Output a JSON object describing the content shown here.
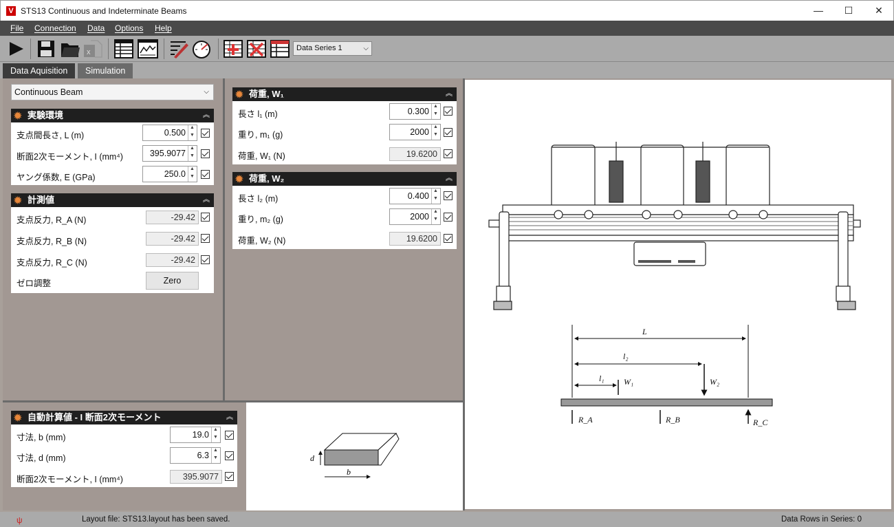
{
  "window": {
    "title": "STS13 Continuous and Indeterminate Beams",
    "logo_letter": "V",
    "min_glyph": "—",
    "max_glyph": "☐",
    "close_glyph": "✕"
  },
  "menu": [
    "File",
    "Connection",
    "Data",
    "Options",
    "Help"
  ],
  "toolbar": {
    "data_series": "Data Series 1",
    "icons": [
      "play-icon",
      "save-icon",
      "open-folder-icon",
      "excel-icon",
      "file-icon",
      "table-icon",
      "graph-icon",
      "pencil-ruler-icon",
      "gauge-icon",
      "add-column-icon",
      "delete-column-icon",
      "table-settings-icon"
    ]
  },
  "tabs": [
    "Data Aquisition",
    "Simulation"
  ],
  "beam_type": "Continuous Beam",
  "env": {
    "title": "実験環境",
    "rows": [
      {
        "label": "支点間長さ, L (m)",
        "value": "0.500"
      },
      {
        "label": "断面2次モーメント, I (mm⁴)",
        "value": "395.9077"
      },
      {
        "label": "ヤング係数, E (GPa)",
        "value": "250.0"
      }
    ]
  },
  "measure": {
    "title": "計測値",
    "rows": [
      {
        "label": "支点反力, R_A (N)",
        "value": "-29.42"
      },
      {
        "label": "支点反力, R_B (N)",
        "value": "-29.42"
      },
      {
        "label": "支点反力, R_C (N)",
        "value": "-29.42"
      }
    ],
    "zero_label": "ゼロ調整",
    "zero_button": "Zero"
  },
  "w1": {
    "title": "荷重, W₁",
    "rows": [
      {
        "label": "長さ l₁ (m)",
        "value": "0.300"
      },
      {
        "label": "重り, m₁ (g)",
        "value": "2000"
      },
      {
        "label": "荷重, W₁ (N)",
        "value": "19.6200"
      }
    ]
  },
  "w2": {
    "title": "荷重, W₂",
    "rows": [
      {
        "label": "長さ l₂ (m)",
        "value": "0.400"
      },
      {
        "label": "重り, m₂ (g)",
        "value": "2000"
      },
      {
        "label": "荷重, W₂ (N)",
        "value": "19.6200"
      }
    ]
  },
  "auto": {
    "title": "自動計算値 - I 断面2次モーメント",
    "rows": [
      {
        "label": "寸法, b (mm)",
        "value": "19.0"
      },
      {
        "label": "寸法, d (mm)",
        "value": "6.3"
      },
      {
        "label": "断面2次モーメント, I (mm⁴)",
        "value": "395.9077"
      }
    ]
  },
  "diagram": {
    "L": "L",
    "l1": "l₁",
    "l2": "l₂",
    "W1": "W₁",
    "W2": "W₂",
    "RA": "R_A",
    "RB": "R_B",
    "RC": "R_C",
    "b": "b",
    "d": "d"
  },
  "status": {
    "message": "Layout file: STS13.layout has been saved.",
    "rows": "Data Rows in Series: 0"
  },
  "colors": {
    "header": "#1f1f1f",
    "gear": "#e8873a",
    "panel_bg": "#a29893",
    "logo": "#cc0000"
  }
}
